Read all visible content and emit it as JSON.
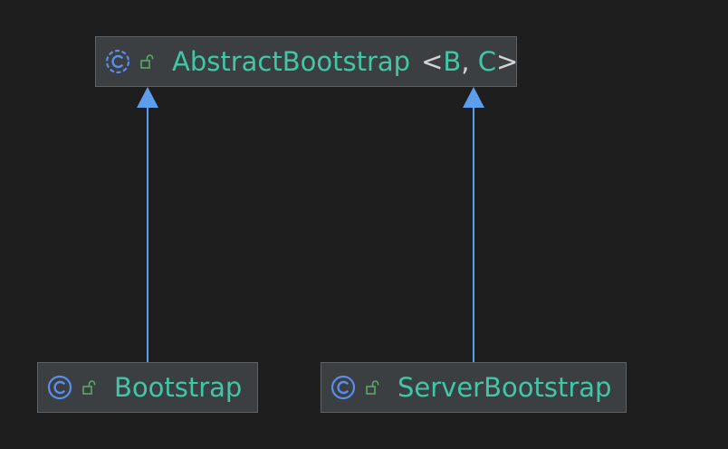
{
  "diagram": {
    "nodes": {
      "abstract_bootstrap": {
        "name": "AbstractBootstrap",
        "type_params": {
          "open": "<",
          "first": "B",
          "sep": ", ",
          "second": "C",
          "close": ">"
        },
        "icon": "abstract-class-icon",
        "visibility_icon": "public-lock-icon"
      },
      "bootstrap": {
        "name": "Bootstrap",
        "icon": "class-icon",
        "visibility_icon": "public-lock-icon"
      },
      "server_bootstrap": {
        "name": "ServerBootstrap",
        "icon": "class-icon",
        "visibility_icon": "public-lock-icon"
      }
    },
    "edges": [
      {
        "from": "bootstrap",
        "to": "abstract_bootstrap",
        "kind": "extends"
      },
      {
        "from": "server_bootstrap",
        "to": "abstract_bootstrap",
        "kind": "extends"
      }
    ],
    "colors": {
      "background": "#1e1e1e",
      "node_fill": "#3c3f41",
      "node_border": "#5f6366",
      "class_name": "#3fc7a6",
      "class_icon": "#5a8dee",
      "lock_icon": "#59a869",
      "edge": "#5c9ded"
    }
  }
}
